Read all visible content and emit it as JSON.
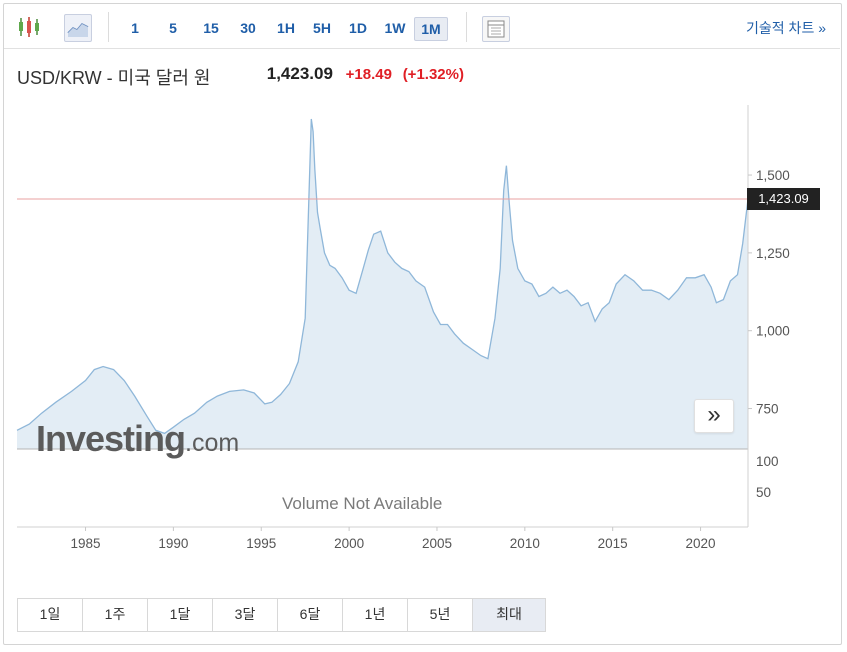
{
  "toolbar": {
    "timeframes": [
      "1",
      "5",
      "15",
      "30",
      "1H",
      "5H",
      "1D",
      "1W",
      "1M"
    ],
    "active_timeframe": "1M",
    "technical_chart_label": "기술적 차트 »"
  },
  "header": {
    "instrument": "USD/KRW - 미국 달러 원",
    "price": "1,423.09",
    "change": "+18.49",
    "change_pct": "(+1.32%)",
    "up_color": "#e01f25"
  },
  "price_tag": "1,423.09",
  "logo": {
    "word": "Investing",
    "suffix": ".com"
  },
  "volume_note": "Volume Not Available",
  "nav_arrows": "»",
  "ranges": [
    "1일",
    "1주",
    "1달",
    "3달",
    "6달",
    "1년",
    "5년",
    "최대"
  ],
  "active_range": "최대",
  "chart_data": {
    "type": "area",
    "title": "",
    "xlabel": "",
    "ylabel": "",
    "x_ticks": [
      1985,
      1990,
      1995,
      2000,
      2005,
      2010,
      2015,
      2020
    ],
    "y_ticks": [
      "750",
      "1,000",
      "1,250",
      "1,500"
    ],
    "volume_ticks": [
      "50",
      "100"
    ],
    "xlim": [
      1981.1,
      2022.7
    ],
    "ylim": [
      620,
      1725
    ],
    "current_price_line": 1423.09,
    "line_color": "#8fb7d9",
    "fill_color": "#e3edf5",
    "series": [
      {
        "x": [
          1981.1,
          1981.8,
          1982.5,
          1983.3,
          1984.2,
          1985.0,
          1985.5,
          1986.0,
          1986.6,
          1987.2,
          1987.8,
          1988.5,
          1989.0,
          1989.5,
          1990.0,
          1990.6,
          1991.2,
          1991.9,
          1992.5,
          1993.2,
          1994.0,
          1994.6,
          1995.2,
          1995.6,
          1996.1,
          1996.6,
          1997.1,
          1997.5,
          1997.85,
          1997.95,
          1998.05,
          1998.2,
          1998.35,
          1998.6,
          1998.9,
          1999.2,
          1999.6,
          2000.0,
          2000.4,
          2000.8,
          2001.1,
          2001.4,
          2001.8,
          2002.2,
          2002.6,
          2003.0,
          2003.4,
          2003.8,
          2004.3,
          2004.8,
          2005.2,
          2005.6,
          2006.0,
          2006.5,
          2007.0,
          2007.5,
          2007.9,
          2008.3,
          2008.6,
          2008.8,
          2008.95,
          2009.1,
          2009.3,
          2009.6,
          2010.0,
          2010.4,
          2010.8,
          2011.2,
          2011.6,
          2012.0,
          2012.4,
          2012.8,
          2013.2,
          2013.6,
          2014.0,
          2014.4,
          2014.8,
          2015.2,
          2015.7,
          2016.2,
          2016.7,
          2017.2,
          2017.7,
          2018.2,
          2018.7,
          2019.2,
          2019.7,
          2020.2,
          2020.6,
          2020.9,
          2021.3,
          2021.7,
          2022.1,
          2022.4,
          2022.7
        ],
        "values": [
          680,
          700,
          735,
          770,
          805,
          840,
          875,
          885,
          875,
          840,
          790,
          725,
          680,
          670,
          690,
          715,
          735,
          770,
          790,
          805,
          810,
          800,
          765,
          770,
          795,
          830,
          900,
          1040,
          1680,
          1640,
          1520,
          1380,
          1330,
          1250,
          1210,
          1200,
          1170,
          1130,
          1120,
          1200,
          1260,
          1310,
          1320,
          1250,
          1220,
          1200,
          1190,
          1160,
          1140,
          1060,
          1020,
          1020,
          990,
          960,
          940,
          920,
          910,
          1040,
          1200,
          1450,
          1530,
          1420,
          1290,
          1200,
          1160,
          1150,
          1110,
          1120,
          1140,
          1120,
          1130,
          1110,
          1080,
          1090,
          1030,
          1070,
          1090,
          1150,
          1180,
          1160,
          1130,
          1130,
          1120,
          1100,
          1130,
          1170,
          1170,
          1180,
          1140,
          1090,
          1100,
          1160,
          1180,
          1280,
          1423.09
        ]
      }
    ]
  }
}
